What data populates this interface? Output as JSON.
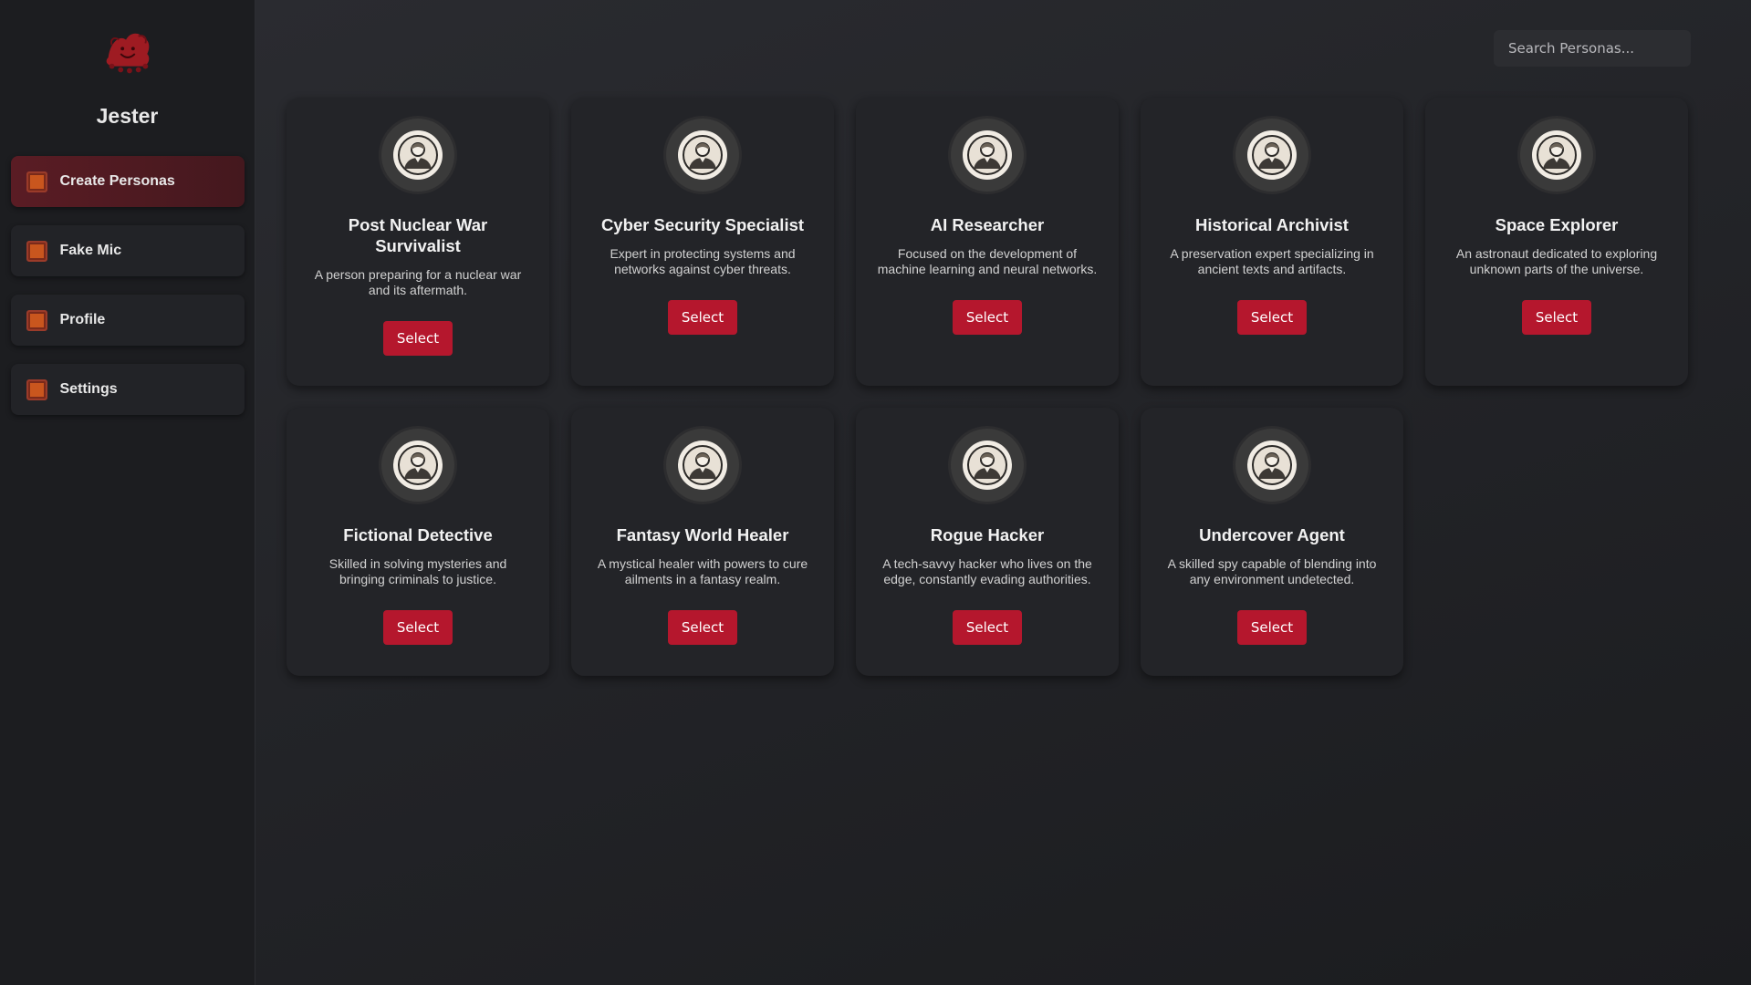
{
  "app": {
    "title": "Jester"
  },
  "sidebar": {
    "items": [
      {
        "label": "Create Personas",
        "icon": "square-icon",
        "active": true
      },
      {
        "label": "Fake Mic",
        "icon": "square-icon",
        "active": false
      },
      {
        "label": "Profile",
        "icon": "square-icon",
        "active": false
      },
      {
        "label": "Settings",
        "icon": "square-icon",
        "active": false
      }
    ]
  },
  "search": {
    "placeholder": "Search Personas..."
  },
  "personas": [
    {
      "title": "Post Nuclear War Survivalist",
      "description": "A person preparing for a nuclear war and its aftermath.",
      "button": "Select"
    },
    {
      "title": "Cyber Security Specialist",
      "description": "Expert in protecting systems and networks against cyber threats.",
      "button": "Select"
    },
    {
      "title": "AI Researcher",
      "description": "Focused on the development of machine learning and neural networks.",
      "button": "Select"
    },
    {
      "title": "Historical Archivist",
      "description": "A preservation expert specializing in ancient texts and artifacts.",
      "button": "Select"
    },
    {
      "title": "Space Explorer",
      "description": "An astronaut dedicated to exploring unknown parts of the universe.",
      "button": "Select"
    },
    {
      "title": "Fictional Detective",
      "description": "Skilled in solving mysteries and bringing criminals to justice.",
      "button": "Select"
    },
    {
      "title": "Fantasy World Healer",
      "description": "A mystical healer with powers to cure ailments in a fantasy realm.",
      "button": "Select"
    },
    {
      "title": "Rogue Hacker",
      "description": "A tech-savvy hacker who lives on the edge, constantly evading authorities.",
      "button": "Select"
    },
    {
      "title": "Undercover Agent",
      "description": "A skilled spy capable of blending into any environment undetected.",
      "button": "Select"
    }
  ],
  "colors": {
    "accent": "#b5172d",
    "active_nav": "#5a1c24",
    "nav_icon": "#c9561e",
    "logo": "#9e1b22"
  }
}
